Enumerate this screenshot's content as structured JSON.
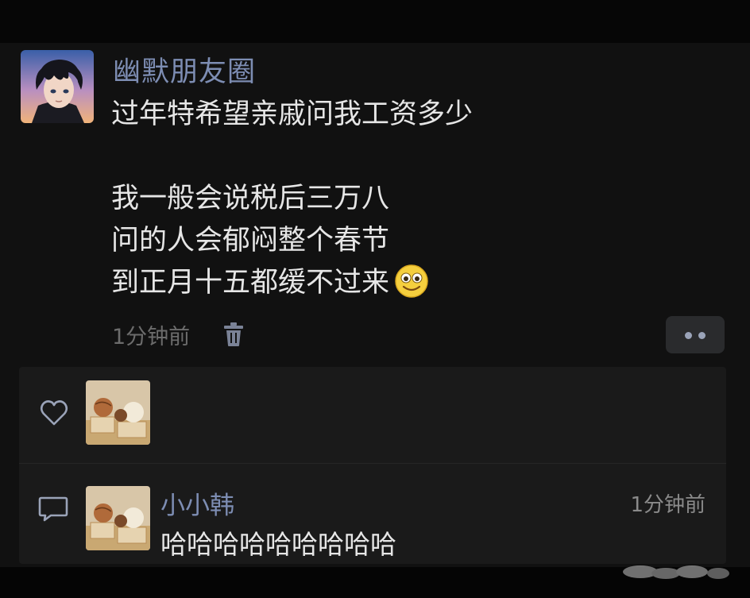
{
  "post": {
    "username": "幽默朋友圈",
    "lines": [
      "过年特希望亲戚问我工资多少",
      "",
      "我一般会说税后三万八",
      "问的人会郁闷整个春节",
      "到正月十五都缓不过来"
    ],
    "emoji_icon": "smiley-face-icon",
    "timestamp": "1分钟前"
  },
  "comment": {
    "name": "小小韩",
    "time": "1分钟前",
    "text": "哈哈哈哈哈哈哈哈哈"
  },
  "colors": {
    "background": "#060606",
    "post_background": "#111111",
    "interaction_background": "#1a1a1a",
    "name_color": "#7d8db3",
    "text_color": "#e6e6e6",
    "meta_color": "#6c6c6c"
  }
}
